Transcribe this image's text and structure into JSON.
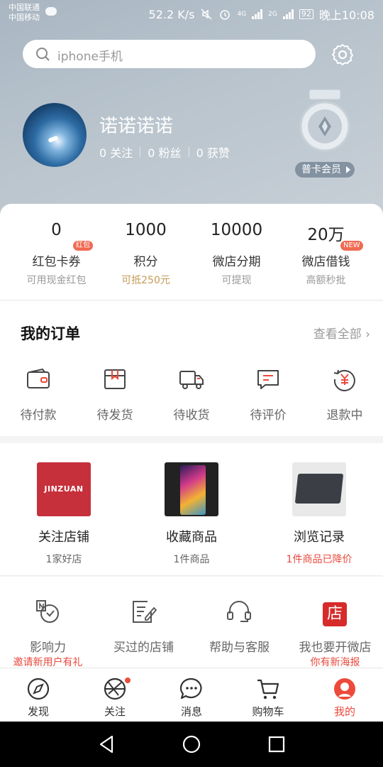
{
  "status_bar": {
    "carrier_1": "中国联通",
    "carrier_2": "中国移动",
    "speed": "52.2 K/s",
    "net_4g": "4G",
    "net_2g": "2G",
    "battery": "92",
    "time": "晚上10:08"
  },
  "search": {
    "placeholder": "iphone手机"
  },
  "profile": {
    "username": "诺诺诺诺",
    "following": "0 关注",
    "fans": "0 粉丝",
    "likes": "0 获赞",
    "member_label": "普卡会员"
  },
  "assets": [
    {
      "value": "0",
      "label": "红包卡券",
      "sub": "可用现金红包",
      "tag": "红包"
    },
    {
      "value": "1000",
      "label": "积分",
      "sub": "可抵250元"
    },
    {
      "value": "10000",
      "label": "微店分期",
      "sub": "可提现"
    },
    {
      "value": "20万",
      "label": "微店借钱",
      "sub": "高额秒批",
      "tag": "NEW"
    }
  ],
  "orders": {
    "title": "我的订单",
    "view_all": "查看全部 ›",
    "items": [
      {
        "label": "待付款",
        "icon": "wallet-icon"
      },
      {
        "label": "待发货",
        "icon": "box-icon"
      },
      {
        "label": "待收货",
        "icon": "truck-icon"
      },
      {
        "label": "待评价",
        "icon": "comment-icon"
      },
      {
        "label": "退款中",
        "icon": "refund-icon"
      }
    ]
  },
  "shops": [
    {
      "label": "关注店铺",
      "sub": "1家好店",
      "image_text": "JINZUAN"
    },
    {
      "label": "收藏商品",
      "sub": "1件商品"
    },
    {
      "label": "浏览记录",
      "sub": "1件商品已降价"
    }
  ],
  "services": [
    {
      "label": "影响力",
      "sub": "邀请新用户有礼",
      "icon": "influence-icon"
    },
    {
      "label": "买过的店铺",
      "sub": "",
      "icon": "edit-list-icon"
    },
    {
      "label": "帮助与客服",
      "sub": "",
      "icon": "headset-icon"
    },
    {
      "label": "我也要开微店",
      "sub": "你有新海报",
      "icon": "store-badge-icon",
      "badge_text": "店"
    }
  ],
  "tabs": [
    {
      "label": "发现",
      "icon": "compass-icon"
    },
    {
      "label": "关注",
      "icon": "aperture-icon"
    },
    {
      "label": "消息",
      "icon": "chat-icon"
    },
    {
      "label": "购物车",
      "icon": "cart-icon"
    },
    {
      "label": "我的",
      "icon": "profile-icon",
      "active": true
    }
  ],
  "colors": {
    "accent": "#ec4a3b",
    "gold": "#c59a55",
    "header_bg": "#b5c1cb"
  }
}
